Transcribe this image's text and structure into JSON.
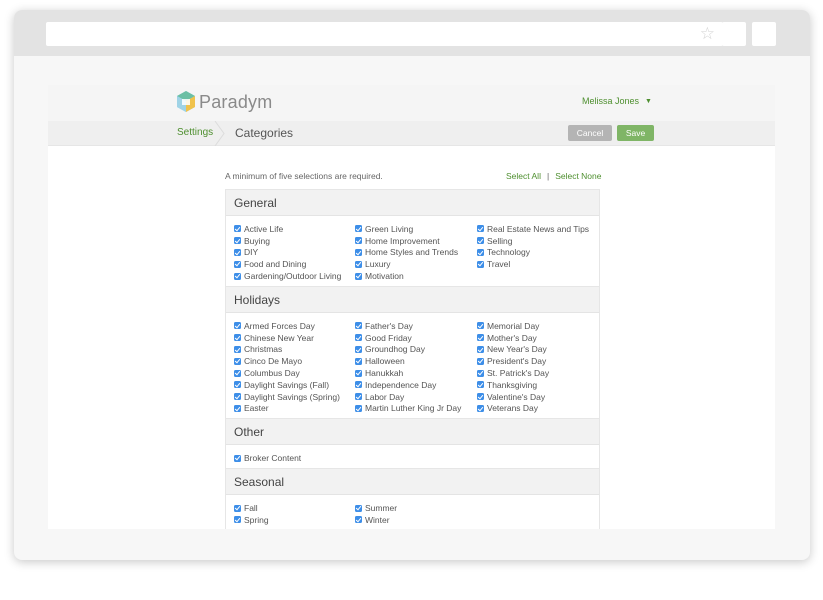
{
  "app": {
    "logo_text": "Paradym",
    "user_name": "Melissa Jones"
  },
  "nav": {
    "breadcrumb_settings": "Settings",
    "page_title": "Categories"
  },
  "actions": {
    "cancel_label": "Cancel",
    "save_label": "Save"
  },
  "notice": "A minimum of five selections are required.",
  "select": {
    "all": "Select All",
    "separator": "|",
    "none": "Select None"
  },
  "colors": {
    "accent_green": "#4e8f2f",
    "save_green": "#7fb566",
    "checkbox_blue": "#3d8ee8",
    "cancel_gray": "#b4b4b4"
  },
  "sections": [
    {
      "title": "General",
      "columns": [
        [
          "Active Life",
          "Buying",
          "DIY",
          "Food and Dining",
          "Gardening/Outdoor Living"
        ],
        [
          "Green Living",
          "Home Improvement",
          "Home Styles and Trends",
          "Luxury",
          "Motivation"
        ],
        [
          "Real Estate News and Tips",
          "Selling",
          "Technology",
          "Travel"
        ]
      ]
    },
    {
      "title": "Holidays",
      "columns": [
        [
          "Armed Forces Day",
          "Chinese New Year",
          "Christmas",
          "Cinco De Mayo",
          "Columbus Day",
          "Daylight Savings (Fall)",
          "Daylight Savings (Spring)",
          "Easter"
        ],
        [
          "Father's Day",
          "Good Friday",
          "Groundhog Day",
          "Halloween",
          "Hanukkah",
          "Independence Day",
          "Labor Day",
          "Martin Luther King Jr Day"
        ],
        [
          "Memorial Day",
          "Mother's Day",
          "New Year's Day",
          "President's Day",
          "St. Patrick's Day",
          "Thanksgiving",
          "Valentine's Day",
          "Veterans Day"
        ]
      ]
    },
    {
      "title": "Other",
      "columns": [
        [
          "Broker Content"
        ],
        [],
        []
      ]
    },
    {
      "title": "Seasonal",
      "columns": [
        [
          "Fall",
          "Spring"
        ],
        [
          "Summer",
          "Winter"
        ],
        []
      ]
    }
  ]
}
